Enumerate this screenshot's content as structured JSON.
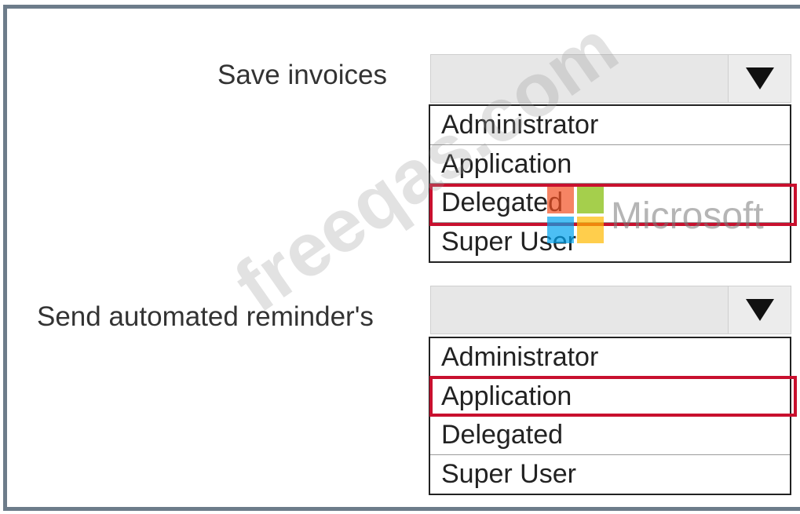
{
  "questions": [
    {
      "label": "Save invoices",
      "dropdown": {
        "selected": "",
        "icon": "triangle-down-icon"
      },
      "options": [
        "Administrator",
        "Application",
        "Delegated",
        "Super User"
      ],
      "highlighted_option": "Delegated"
    },
    {
      "label": "Send automated reminder's",
      "dropdown": {
        "selected": "",
        "icon": "triangle-down-icon"
      },
      "options": [
        "Administrator",
        "Application",
        "Delegated",
        "Super User"
      ],
      "highlighted_option": "Application"
    }
  ],
  "watermarks": {
    "logo_brand_text": "Microsoft",
    "diagonal_text": "freeqas.com",
    "logo_colors": [
      "#f25022",
      "#7fba00",
      "#00a4ef",
      "#ffb900"
    ]
  },
  "colors": {
    "highlight": "#c8102e",
    "frame": "#6d7c8a"
  }
}
